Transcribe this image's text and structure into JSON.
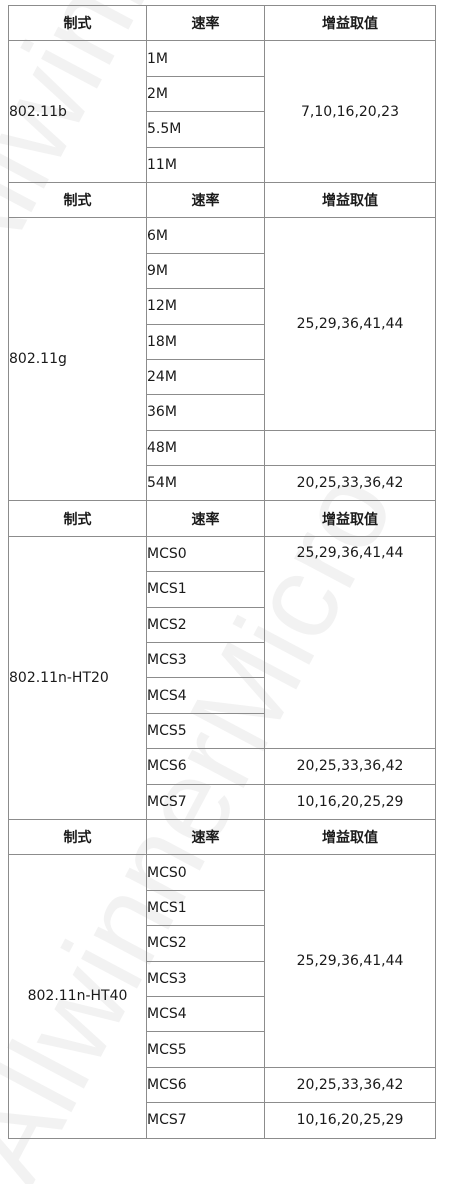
{
  "headers": {
    "mode": "制式",
    "rate": "速率",
    "gain": "增益取值"
  },
  "sections": [
    {
      "mode": "802.11b",
      "rates": [
        "1M",
        "2M",
        "5.5M",
        "11M"
      ],
      "gains": [
        "7,10,16,20,23"
      ]
    },
    {
      "mode": "802.11g",
      "rates": [
        "6M",
        "9M",
        "12M",
        "18M",
        "24M",
        "36M",
        "48M",
        "54M"
      ],
      "gains": [
        "25,29,36,41,44",
        "",
        "20,25,33,36,42"
      ]
    },
    {
      "mode": "802.11n-HT20",
      "rates": [
        "MCS0",
        "MCS1",
        "MCS2",
        "MCS3",
        "MCS4",
        "MCS5",
        "MCS6",
        "MCS7"
      ],
      "gains": [
        "25,29,36,41,44",
        "20,25,33,36,42",
        "10,16,20,25,29"
      ]
    },
    {
      "mode": "802.11n-HT40",
      "rates": [
        "MCS0",
        "MCS1",
        "MCS2",
        "MCS3",
        "MCS4",
        "MCS5",
        "MCS6",
        "MCS7"
      ],
      "gains": [
        "25,29,36,41,44",
        "20,25,33,36,42",
        "10,16,20,25,29"
      ]
    }
  ],
  "watermark": "AllwinnerMicro"
}
